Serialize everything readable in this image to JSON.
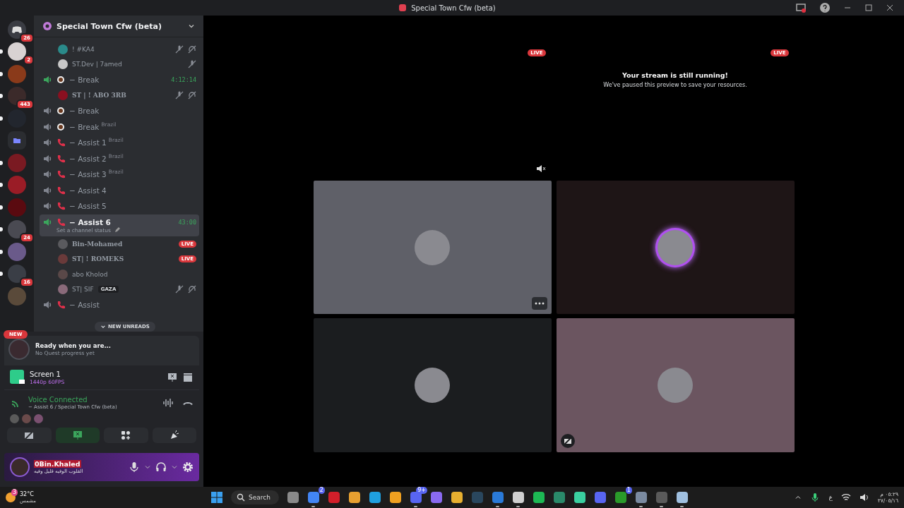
{
  "window": {
    "title": "Special Town Cfw (beta)"
  },
  "servers": [
    {
      "kind": "home",
      "color": "#3a3c43",
      "badge": "26",
      "unread": false
    },
    {
      "kind": "server",
      "color": "#d8d2d2",
      "badge": "2",
      "unread": true
    },
    {
      "kind": "server",
      "color": "#8a3a1a",
      "unread": true
    },
    {
      "kind": "server",
      "color": "#3b2a2a",
      "badge": "443",
      "unread": true
    },
    {
      "kind": "server",
      "color": "#22262e",
      "unread": true
    },
    {
      "kind": "folder",
      "color": "#2b2d31",
      "unread": false
    },
    {
      "kind": "server",
      "color": "#7a1a22",
      "unread": true
    },
    {
      "kind": "server",
      "color": "#9a1c26",
      "unread": true
    },
    {
      "kind": "server",
      "color": "#5a0a10",
      "unread": true
    },
    {
      "kind": "server",
      "color": "#4a4a52",
      "badge": "24",
      "unread": true
    },
    {
      "kind": "server",
      "color": "#6a5a8a",
      "unread": true
    },
    {
      "kind": "server",
      "color": "#3a3e46",
      "badge": "16",
      "unread": true
    },
    {
      "kind": "server",
      "color": "#5a4a3a",
      "unread": false
    }
  ],
  "new_pill": "NEW",
  "server_header": {
    "name": "Special Town Cfw (beta)"
  },
  "channels": [
    {
      "kind": "user",
      "name": "! #KA4",
      "color": "#2a8a8a",
      "bold": false,
      "muted": true,
      "deafened": true
    },
    {
      "kind": "user",
      "name": "ST.Dev | 7amed",
      "color": "#c8c8c8",
      "bold": false,
      "muted": true,
      "deafened": false
    },
    {
      "kind": "lounge",
      "name": "− Break",
      "active": true,
      "selected": false,
      "timer": "4:12:14"
    },
    {
      "kind": "user",
      "name": "ST | ! ABO 3RB",
      "color": "#8a1020",
      "bold": true,
      "muted": true,
      "deafened": true
    },
    {
      "kind": "lounge",
      "name": "− Break",
      "active": false,
      "selected": false
    },
    {
      "kind": "lounge",
      "name": "− Break",
      "tag": "Brazil",
      "active": false,
      "selected": false
    },
    {
      "kind": "call",
      "name": "− Assist 1",
      "tag": "Brazil",
      "active": false,
      "selected": false
    },
    {
      "kind": "call",
      "name": "− Assist 2",
      "tag": "Brazil",
      "active": false,
      "selected": false
    },
    {
      "kind": "call",
      "name": "− Assist 3",
      "tag": "Brazil",
      "active": false,
      "selected": false
    },
    {
      "kind": "call",
      "name": "− Assist 4",
      "active": false,
      "selected": false
    },
    {
      "kind": "call",
      "name": "− Assist 5",
      "active": false,
      "selected": false
    },
    {
      "kind": "call",
      "name": "− Assist 6",
      "active": true,
      "selected": true,
      "timer": "43:00",
      "status": "Set a channel status"
    },
    {
      "kind": "user",
      "name": "Bin-Mohamed",
      "color": "#5a5a5e",
      "bold": true,
      "badge": "LIVE",
      "muted": false,
      "deafened": false
    },
    {
      "kind": "user",
      "name": "ST| ! ROMEKS",
      "color": "#6a3a3a",
      "bold": true,
      "badge": "LIVE",
      "muted": false,
      "deafened": false
    },
    {
      "kind": "user",
      "name": "abo Kholod",
      "color": "#5a4848",
      "bold": false,
      "muted": false,
      "deafened": false
    },
    {
      "kind": "user",
      "name": "ST| SIF",
      "color": "#8a6a7a",
      "bold": false,
      "tag": "GAZA",
      "muted": true,
      "deafened": true
    },
    {
      "kind": "call",
      "name": "− Assist",
      "active": false,
      "selected": false
    }
  ],
  "new_unreads": "NEW UNREADS",
  "quest": {
    "title": "Ready when you are...",
    "subtitle": "No Quest progress yet"
  },
  "stream": {
    "title": "Screen 1",
    "quality": "1440p 60FPS"
  },
  "voice": {
    "title": "Voice Connected",
    "channel": "− Assist 6 / Special Town Cfw (beta)",
    "participants": [
      {
        "color": "#5a5a5a"
      },
      {
        "color": "#6a4a4a"
      },
      {
        "color": "#7a5070"
      }
    ]
  },
  "controls": [
    {
      "kind": "camera",
      "active": false
    },
    {
      "kind": "screen",
      "active": true
    },
    {
      "kind": "activities",
      "active": false
    },
    {
      "kind": "soundboard",
      "active": false
    }
  ],
  "user": {
    "name": "0Bin.Khaled",
    "status": "القلوب الوفيه قليل وفيه"
  },
  "streams": [
    {
      "caption": "LIVE",
      "muted": true
    },
    {
      "caption": "LIVE",
      "muted": false,
      "message": "Your stream is still running!",
      "note": "We've paused this preview to save your resources."
    }
  ],
  "tiles": [
    {
      "color": "#5f6068",
      "speaking": false,
      "menu": true,
      "video_off": false
    },
    {
      "color": "#1e1516",
      "speaking": true,
      "menu": false,
      "video_off": false
    },
    {
      "color": "#1b1d1f",
      "speaking": false,
      "menu": false,
      "video_off": false
    },
    {
      "color": "#6b5560",
      "speaking": false,
      "menu": false,
      "video_off": true
    }
  ],
  "taskbar": {
    "weather": {
      "temp": "32°C",
      "condition": "مشمس",
      "badge": "3"
    },
    "search": "Search",
    "apps": [
      {
        "color": "#8a8a8a",
        "running": false
      },
      {
        "color": "#4285f4",
        "running": true,
        "badge": "2"
      },
      {
        "color": "#d21f2a",
        "running": false
      },
      {
        "color": "#e8a030",
        "running": false
      },
      {
        "color": "#1fa0e0",
        "running": false
      },
      {
        "color": "#f0a020",
        "running": false
      },
      {
        "color": "#5865f2",
        "running": true,
        "badge": "9+"
      },
      {
        "color": "#8a6af0",
        "running": false
      },
      {
        "color": "#e8b030",
        "running": false
      },
      {
        "color": "#2a475e",
        "running": false
      },
      {
        "color": "#2a7ad8",
        "running": true
      },
      {
        "color": "#d0d0d0",
        "running": true
      },
      {
        "color": "#1db954",
        "running": false
      },
      {
        "color": "#2a8a6a",
        "running": false
      },
      {
        "color": "#3ad0a0",
        "running": false
      },
      {
        "color": "#5865f2",
        "running": false
      },
      {
        "color": "#2a9a2a",
        "running": false,
        "badge": "1"
      },
      {
        "color": "#7a8aa0",
        "running": true
      },
      {
        "color": "#5a5a5a",
        "running": true
      },
      {
        "color": "#a0c0e0",
        "running": true
      }
    ],
    "language": "ع",
    "time": "٠٥:٢٩ م",
    "date": "٢٧/٠٥/١٦"
  }
}
